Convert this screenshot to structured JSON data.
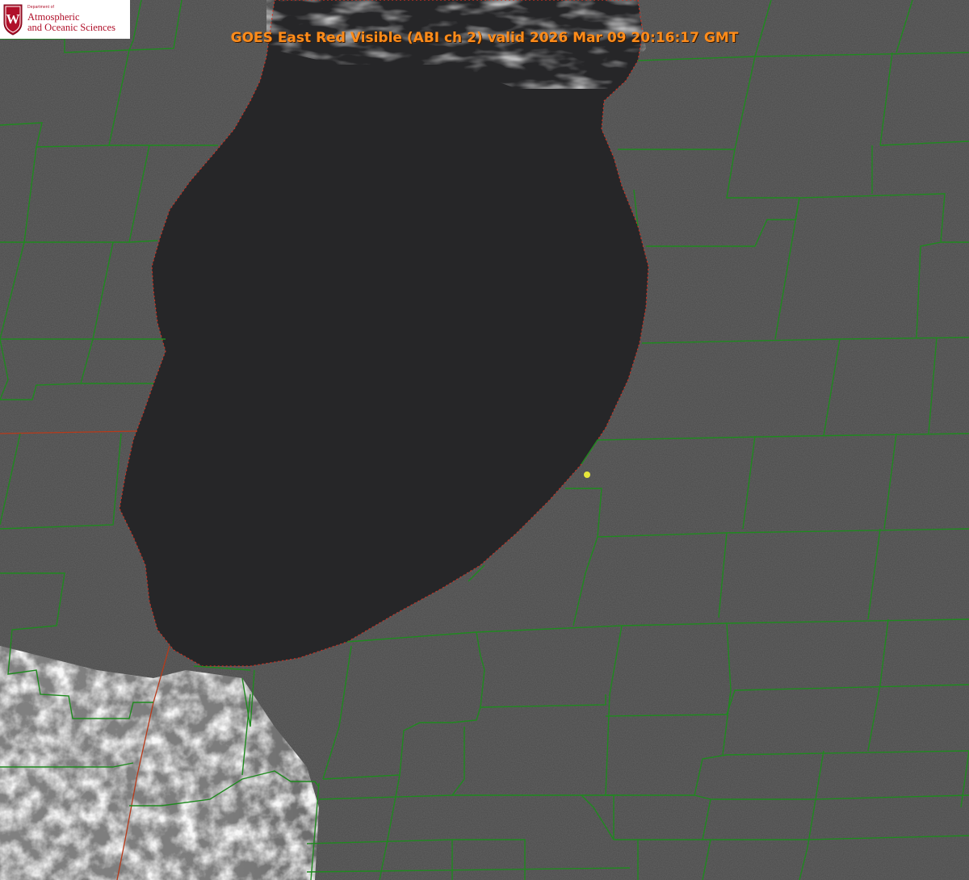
{
  "logo": {
    "crest_letter": "W",
    "department_line": "Department of",
    "name_line1": "Atmospheric",
    "name_line2": "and Oceanic Sciences"
  },
  "header": {
    "title": "GOES East Red Visible (ABI ch 2) valid 2026 Mar 09 20:16:17 GMT"
  },
  "colors": {
    "land": "#4a4a4a",
    "lake": "#262628",
    "county_lines": "#1f8a1f",
    "state_lines": "#b83a1a",
    "shoreline_dots": "#d03020",
    "title_text": "#ff8c1a",
    "logo_red": "#b0102a",
    "station_marker": "#e8e83a"
  },
  "icons": {
    "crest": "wisconsin-crest-icon",
    "station": "station-marker-icon"
  }
}
